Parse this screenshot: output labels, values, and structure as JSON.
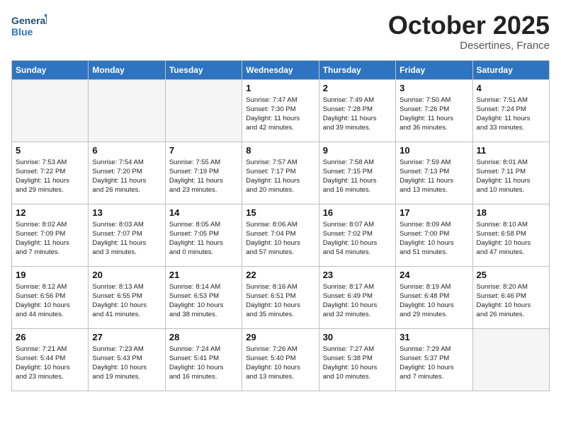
{
  "header": {
    "logo_line1": "General",
    "logo_line2": "Blue",
    "month": "October 2025",
    "location": "Desertines, France"
  },
  "days_of_week": [
    "Sunday",
    "Monday",
    "Tuesday",
    "Wednesday",
    "Thursday",
    "Friday",
    "Saturday"
  ],
  "weeks": [
    [
      {
        "day": "",
        "info": ""
      },
      {
        "day": "",
        "info": ""
      },
      {
        "day": "",
        "info": ""
      },
      {
        "day": "1",
        "info": "Sunrise: 7:47 AM\nSunset: 7:30 PM\nDaylight: 11 hours\nand 42 minutes."
      },
      {
        "day": "2",
        "info": "Sunrise: 7:49 AM\nSunset: 7:28 PM\nDaylight: 11 hours\nand 39 minutes."
      },
      {
        "day": "3",
        "info": "Sunrise: 7:50 AM\nSunset: 7:26 PM\nDaylight: 11 hours\nand 36 minutes."
      },
      {
        "day": "4",
        "info": "Sunrise: 7:51 AM\nSunset: 7:24 PM\nDaylight: 11 hours\nand 33 minutes."
      }
    ],
    [
      {
        "day": "5",
        "info": "Sunrise: 7:53 AM\nSunset: 7:22 PM\nDaylight: 11 hours\nand 29 minutes."
      },
      {
        "day": "6",
        "info": "Sunrise: 7:54 AM\nSunset: 7:20 PM\nDaylight: 11 hours\nand 26 minutes."
      },
      {
        "day": "7",
        "info": "Sunrise: 7:55 AM\nSunset: 7:19 PM\nDaylight: 11 hours\nand 23 minutes."
      },
      {
        "day": "8",
        "info": "Sunrise: 7:57 AM\nSunset: 7:17 PM\nDaylight: 11 hours\nand 20 minutes."
      },
      {
        "day": "9",
        "info": "Sunrise: 7:58 AM\nSunset: 7:15 PM\nDaylight: 11 hours\nand 16 minutes."
      },
      {
        "day": "10",
        "info": "Sunrise: 7:59 AM\nSunset: 7:13 PM\nDaylight: 11 hours\nand 13 minutes."
      },
      {
        "day": "11",
        "info": "Sunrise: 8:01 AM\nSunset: 7:11 PM\nDaylight: 11 hours\nand 10 minutes."
      }
    ],
    [
      {
        "day": "12",
        "info": "Sunrise: 8:02 AM\nSunset: 7:09 PM\nDaylight: 11 hours\nand 7 minutes."
      },
      {
        "day": "13",
        "info": "Sunrise: 8:03 AM\nSunset: 7:07 PM\nDaylight: 11 hours\nand 3 minutes."
      },
      {
        "day": "14",
        "info": "Sunrise: 8:05 AM\nSunset: 7:05 PM\nDaylight: 11 hours\nand 0 minutes."
      },
      {
        "day": "15",
        "info": "Sunrise: 8:06 AM\nSunset: 7:04 PM\nDaylight: 10 hours\nand 57 minutes."
      },
      {
        "day": "16",
        "info": "Sunrise: 8:07 AM\nSunset: 7:02 PM\nDaylight: 10 hours\nand 54 minutes."
      },
      {
        "day": "17",
        "info": "Sunrise: 8:09 AM\nSunset: 7:00 PM\nDaylight: 10 hours\nand 51 minutes."
      },
      {
        "day": "18",
        "info": "Sunrise: 8:10 AM\nSunset: 6:58 PM\nDaylight: 10 hours\nand 47 minutes."
      }
    ],
    [
      {
        "day": "19",
        "info": "Sunrise: 8:12 AM\nSunset: 6:56 PM\nDaylight: 10 hours\nand 44 minutes."
      },
      {
        "day": "20",
        "info": "Sunrise: 8:13 AM\nSunset: 6:55 PM\nDaylight: 10 hours\nand 41 minutes."
      },
      {
        "day": "21",
        "info": "Sunrise: 8:14 AM\nSunset: 6:53 PM\nDaylight: 10 hours\nand 38 minutes."
      },
      {
        "day": "22",
        "info": "Sunrise: 8:16 AM\nSunset: 6:51 PM\nDaylight: 10 hours\nand 35 minutes."
      },
      {
        "day": "23",
        "info": "Sunrise: 8:17 AM\nSunset: 6:49 PM\nDaylight: 10 hours\nand 32 minutes."
      },
      {
        "day": "24",
        "info": "Sunrise: 8:19 AM\nSunset: 6:48 PM\nDaylight: 10 hours\nand 29 minutes."
      },
      {
        "day": "25",
        "info": "Sunrise: 8:20 AM\nSunset: 6:46 PM\nDaylight: 10 hours\nand 26 minutes."
      }
    ],
    [
      {
        "day": "26",
        "info": "Sunrise: 7:21 AM\nSunset: 5:44 PM\nDaylight: 10 hours\nand 23 minutes."
      },
      {
        "day": "27",
        "info": "Sunrise: 7:23 AM\nSunset: 5:43 PM\nDaylight: 10 hours\nand 19 minutes."
      },
      {
        "day": "28",
        "info": "Sunrise: 7:24 AM\nSunset: 5:41 PM\nDaylight: 10 hours\nand 16 minutes."
      },
      {
        "day": "29",
        "info": "Sunrise: 7:26 AM\nSunset: 5:40 PM\nDaylight: 10 hours\nand 13 minutes."
      },
      {
        "day": "30",
        "info": "Sunrise: 7:27 AM\nSunset: 5:38 PM\nDaylight: 10 hours\nand 10 minutes."
      },
      {
        "day": "31",
        "info": "Sunrise: 7:29 AM\nSunset: 5:37 PM\nDaylight: 10 hours\nand 7 minutes."
      },
      {
        "day": "",
        "info": ""
      }
    ]
  ]
}
